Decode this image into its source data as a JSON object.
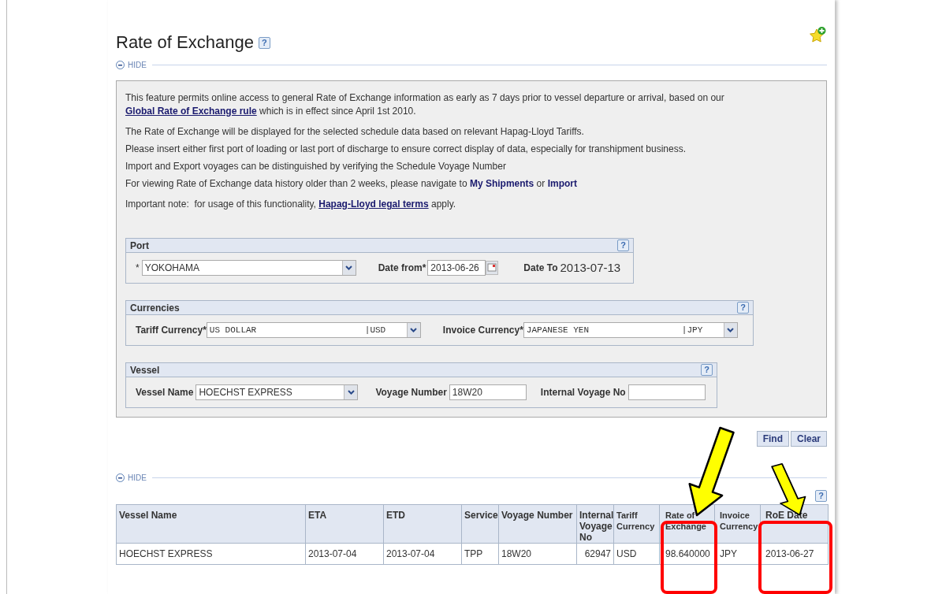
{
  "page": {
    "title": "Rate of Exchange",
    "help": "?"
  },
  "info_section": {
    "toggle": "HIDE",
    "paragraphs": [
      [
        {
          "kind": "text",
          "text": "This feature permits online access to general Rate of Exchange information as early as 7 days prior to vessel departure or arrival, based on our "
        },
        {
          "kind": "link",
          "text": "Global Rate of Exchange rule"
        },
        {
          "kind": "text",
          "text": " which is in effect since April 1st 2010."
        }
      ],
      [
        {
          "kind": "text",
          "text": "The Rate of Exchange will be displayed for the selected schedule data based on relevant Hapag-Lloyd Tariffs."
        }
      ],
      [
        {
          "kind": "text",
          "text": "Please insert either first port of loading or last port of discharge to ensure correct display of data, especially for transhipment business."
        }
      ],
      [
        {
          "kind": "text",
          "text": "Import and Export voyages can be distinguished by verifying the Schedule Voyage Number"
        }
      ],
      [
        {
          "kind": "text",
          "text": "For viewing Rate of Exchange data history older than 2 weeks, please navigate to "
        },
        {
          "kind": "nav_link",
          "text": "My Shipments"
        },
        {
          "kind": "text",
          "text": " or "
        },
        {
          "kind": "nav_link",
          "text": "Import"
        }
      ],
      [
        {
          "kind": "text",
          "text": "Important note:  for usage of this functionality, "
        },
        {
          "kind": "link",
          "text": "Hapag-Lloyd legal terms"
        },
        {
          "kind": "text",
          "text": " apply."
        }
      ]
    ]
  },
  "port": {
    "title": "Port",
    "help": "?",
    "required_mark": "*",
    "port": "YOKOHAMA",
    "date_from_label": "Date from*",
    "date_from": "2013-06-26",
    "date_to_label": "Date To",
    "date_to": "2013-07-13"
  },
  "currencies": {
    "title": "Currencies",
    "help": "?",
    "tariff_label": "Tariff Currency*",
    "tariff_name": "US DOLLAR",
    "tariff_code": "|USD",
    "invoice_label": "Invoice Currency*",
    "invoice_name": "JAPANESE YEN",
    "invoice_code": "|JPY"
  },
  "vessel": {
    "title": "Vessel",
    "help": "?",
    "vessel_label": "Vessel Name",
    "vessel_name": "HOECHST EXPRESS",
    "voyage_label": "Voyage Number",
    "voyage": "18W20",
    "internal_label": "Internal Voyage No"
  },
  "buttons": [
    "Find",
    "Clear"
  ],
  "results": {
    "toggle": "HIDE",
    "help": "?",
    "columns": [
      "Vessel Name",
      "ETA",
      "ETD",
      "Service",
      "Voyage Number",
      "Internal Voyage No",
      "Tariff Currency",
      "Rate of Exchange",
      "Invoice Currency",
      "RoE Date"
    ],
    "rows": [
      [
        "HOECHST EXPRESS",
        "2013-07-04",
        "2013-07-04",
        "TPP",
        "18W20",
        "62947",
        "USD",
        "98.640000",
        "JPY",
        "2013-06-27"
      ]
    ]
  }
}
